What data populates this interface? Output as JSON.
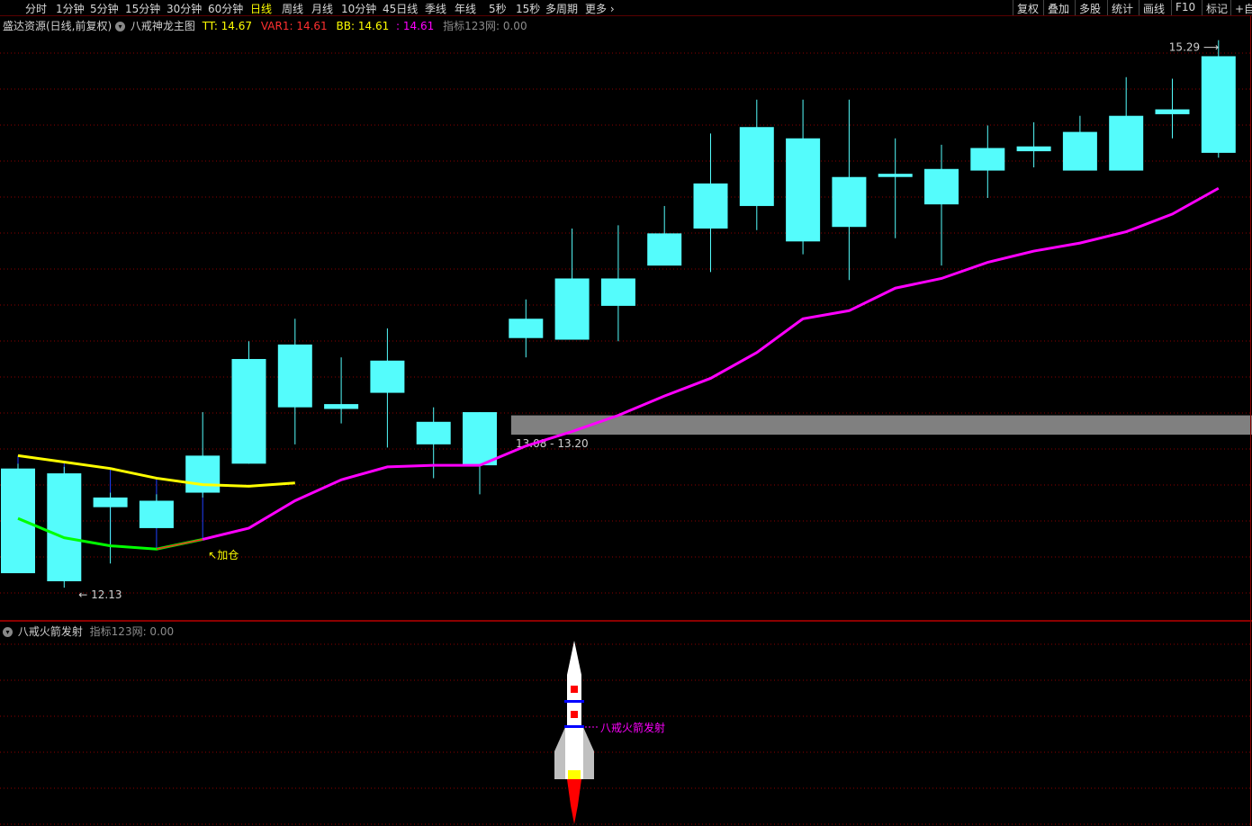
{
  "toolbar": {
    "periods": [
      "分时",
      "1分钟",
      "5分钟",
      "15分钟",
      "30分钟",
      "60分钟",
      "日线",
      "周线",
      "月线",
      "10分钟",
      "45日线",
      "季线",
      "年线",
      "5秒",
      "15秒",
      "多周期",
      "更多"
    ],
    "active": "日线",
    "right": [
      "复权",
      "叠加",
      "多股",
      "统计",
      "画线",
      "F10",
      "标记",
      "+自"
    ]
  },
  "main_header": {
    "title": "盛达资源(日线,前复权)",
    "indicator": "八戒神龙主图",
    "tt": "TT: 14.67",
    "var1": "VAR1: 14.61",
    "bb": "BB: 14.61",
    "line_val": ": 14.61",
    "net": "指标123网: 0.00"
  },
  "sub_header": {
    "indicator": "八戒火箭发射",
    "net": "指标123网: 0.00"
  },
  "annotations": {
    "high": "15.29",
    "low": "12.13",
    "zone": "13.08 - 13.20",
    "add_position": "加仓",
    "rocket_label": "八戒火箭发射"
  },
  "colors": {
    "up": "#ff4444",
    "down": "#54fcfc",
    "ma": "#ff00ff",
    "upper": "#ffff00",
    "lower": "#00ff00",
    "grid": "#8b0000",
    "zone": "#808080"
  },
  "chart_data": {
    "type": "candlestick",
    "ylim": [
      11.98,
      15.55
    ],
    "candles": [
      {
        "o": 12.87,
        "h": 12.9,
        "l": 12.22,
        "c": 12.22
      },
      {
        "o": 12.84,
        "h": 12.88,
        "l": 12.13,
        "c": 12.17
      },
      {
        "o": 12.69,
        "h": 12.72,
        "l": 12.28,
        "c": 12.63
      },
      {
        "o": 12.67,
        "h": 12.71,
        "l": 12.5,
        "c": 12.5
      },
      {
        "o": 12.95,
        "h": 13.22,
        "l": 12.69,
        "c": 12.72
      },
      {
        "o": 13.55,
        "h": 13.66,
        "l": 12.9,
        "c": 12.9
      },
      {
        "o": 13.64,
        "h": 13.8,
        "l": 13.02,
        "c": 13.25
      },
      {
        "o": 13.27,
        "h": 13.56,
        "l": 13.15,
        "c": 13.24
      },
      {
        "o": 13.54,
        "h": 13.74,
        "l": 13.0,
        "c": 13.34
      },
      {
        "o": 13.16,
        "h": 13.25,
        "l": 12.81,
        "c": 13.02
      },
      {
        "o": 13.22,
        "h": 13.22,
        "l": 12.71,
        "c": 12.89
      },
      {
        "o": 13.8,
        "h": 13.92,
        "l": 13.56,
        "c": 13.68
      },
      {
        "o": 14.05,
        "h": 14.36,
        "l": 13.73,
        "c": 13.67
      },
      {
        "o": 14.05,
        "h": 14.38,
        "l": 13.66,
        "c": 13.88
      },
      {
        "o": 14.33,
        "h": 14.5,
        "l": 14.14,
        "c": 14.13
      },
      {
        "o": 14.64,
        "h": 14.95,
        "l": 14.09,
        "c": 14.36
      },
      {
        "o": 14.99,
        "h": 15.16,
        "l": 14.35,
        "c": 14.5
      },
      {
        "o": 14.92,
        "h": 15.16,
        "l": 14.2,
        "c": 14.28
      },
      {
        "o": 14.68,
        "h": 15.16,
        "l": 14.04,
        "c": 14.37
      },
      {
        "o": 14.7,
        "h": 14.92,
        "l": 14.3,
        "c": 14.68
      },
      {
        "o": 14.73,
        "h": 14.88,
        "l": 14.13,
        "c": 14.51
      },
      {
        "o": 14.86,
        "h": 15.0,
        "l": 14.55,
        "c": 14.72
      },
      {
        "o": 14.87,
        "h": 15.02,
        "l": 14.74,
        "c": 14.84
      },
      {
        "o": 14.96,
        "h": 15.06,
        "l": 14.82,
        "c": 14.72
      },
      {
        "o": 15.06,
        "h": 15.3,
        "l": 14.75,
        "c": 14.72
      },
      {
        "o": 15.1,
        "h": 15.29,
        "l": 14.92,
        "c": 15.07
      },
      {
        "o": 15.43,
        "h": 15.53,
        "l": 14.8,
        "c": 14.83
      }
    ],
    "ma": [
      null,
      null,
      null,
      null,
      12.43,
      12.5,
      12.67,
      12.8,
      12.88,
      12.89,
      12.89,
      13.01,
      13.1,
      13.2,
      13.32,
      13.43,
      13.59,
      13.8,
      13.85,
      13.99,
      14.05,
      14.15,
      14.22,
      14.27,
      14.34,
      14.45,
      14.61
    ],
    "upper": [
      12.95,
      12.91,
      12.87,
      12.81,
      12.77,
      12.76,
      12.78,
      null,
      null,
      null,
      null,
      null,
      null,
      null,
      null,
      null,
      null,
      null,
      null,
      null,
      null,
      null,
      null,
      null,
      null,
      null,
      null
    ],
    "lower": [
      12.56,
      12.44,
      12.39,
      12.37,
      12.43,
      null,
      null,
      null,
      null,
      null,
      null,
      null,
      null,
      null,
      null,
      null,
      null,
      null,
      null,
      null,
      null,
      null,
      null,
      null,
      null,
      null,
      null
    ],
    "zone": [
      13.08,
      13.2
    ]
  }
}
